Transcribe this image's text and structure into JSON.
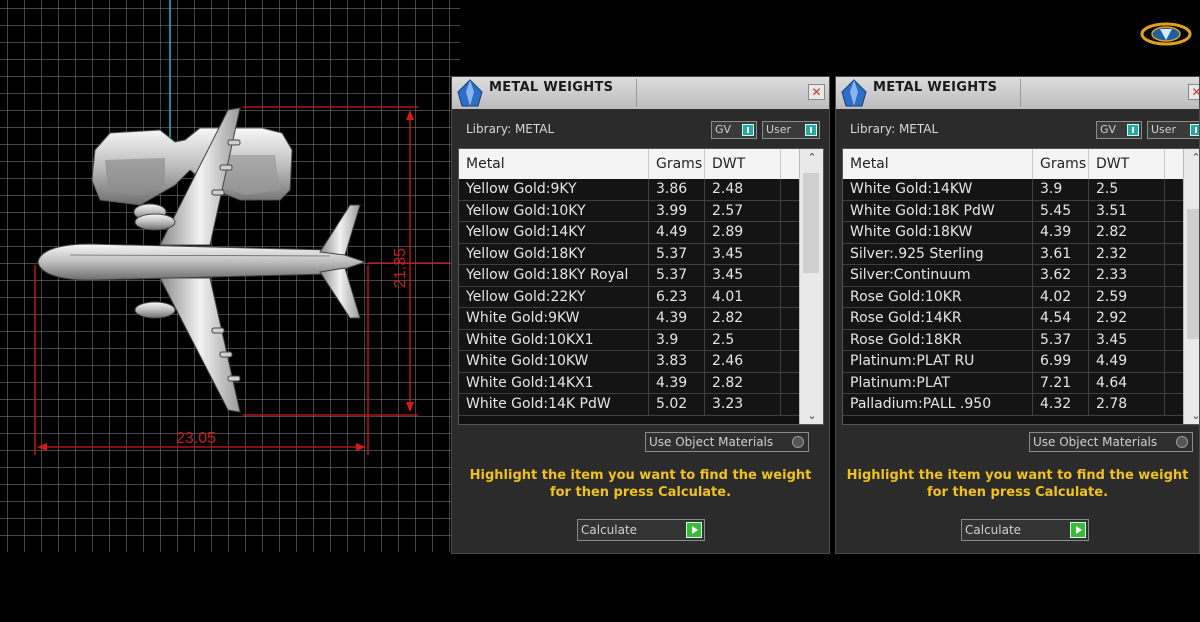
{
  "viewport": {
    "width_dimension": "23.05",
    "height_dimension": "21.35"
  },
  "panels": [
    {
      "title": "METAL WEIGHTS",
      "library_label": "Library: METAL",
      "toggle_gv": "GV",
      "toggle_user": "User",
      "columns": [
        "Metal",
        "Grams",
        "DWT"
      ],
      "rows": [
        [
          "Yellow Gold:9KY",
          "3.86",
          "2.48"
        ],
        [
          "Yellow Gold:10KY",
          "3.99",
          "2.57"
        ],
        [
          "Yellow Gold:14KY",
          "4.49",
          "2.89"
        ],
        [
          "Yellow Gold:18KY",
          "5.37",
          "3.45"
        ],
        [
          "Yellow Gold:18KY Royal",
          "5.37",
          "3.45"
        ],
        [
          "Yellow Gold:22KY",
          "6.23",
          "4.01"
        ],
        [
          "White Gold:9KW",
          "4.39",
          "2.82"
        ],
        [
          "White Gold:10KX1",
          "3.9",
          "2.5"
        ],
        [
          "White Gold:10KW",
          "3.83",
          "2.46"
        ],
        [
          "White Gold:14KX1",
          "4.39",
          "2.82"
        ],
        [
          "White Gold:14K PdW",
          "5.02",
          "3.23"
        ]
      ],
      "use_object_materials": "Use Object Materials",
      "hint": "Highlight the item you want to find the weight for then press Calculate.",
      "calculate": "Calculate"
    },
    {
      "title": "METAL WEIGHTS",
      "library_label": "Library: METAL",
      "toggle_gv": "GV",
      "toggle_user": "User",
      "columns": [
        "Metal",
        "Grams",
        "DWT"
      ],
      "rows": [
        [
          "White Gold:14KW",
          "3.9",
          "2.5"
        ],
        [
          "White Gold:18K PdW",
          "5.45",
          "3.51"
        ],
        [
          "White Gold:18KW",
          "4.39",
          "2.82"
        ],
        [
          "Silver:.925 Sterling",
          "3.61",
          "2.32"
        ],
        [
          "Silver:Continuum",
          "3.62",
          "2.33"
        ],
        [
          "Rose Gold:10KR",
          "4.02",
          "2.59"
        ],
        [
          "Rose Gold:14KR",
          "4.54",
          "2.92"
        ],
        [
          "Rose Gold:18KR",
          "5.37",
          "3.45"
        ],
        [
          "Platinum:PLAT RU",
          "6.99",
          "4.49"
        ],
        [
          "Platinum:PLAT",
          "7.21",
          "4.64"
        ],
        [
          "Palladium:PALL .950",
          "4.32",
          "2.78"
        ]
      ],
      "use_object_materials": "Use Object Materials",
      "hint": "Highlight the item you want to find the weight for then press Calculate.",
      "calculate": "Calculate"
    }
  ],
  "colors": {
    "hint_text": "#f0c21a",
    "dimension_lines": "#d11a1a",
    "toggle_on": "#2aa8a0",
    "calculate_go": "#3db838"
  }
}
